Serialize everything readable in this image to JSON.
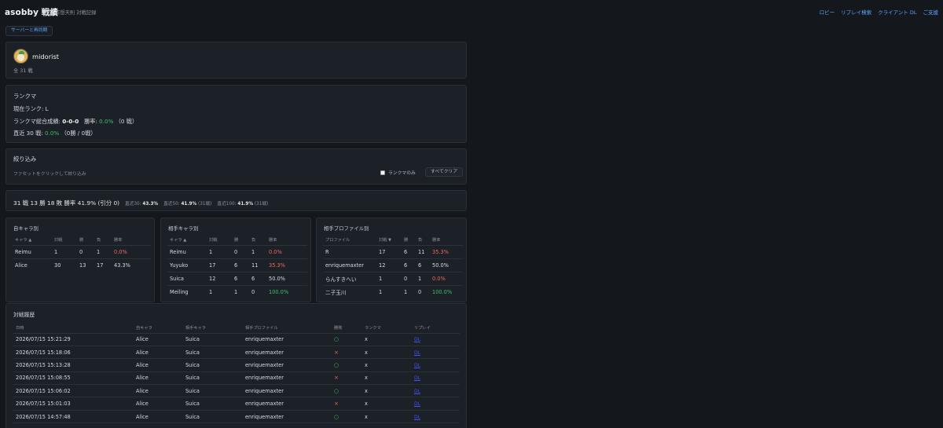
{
  "header": {
    "brand": "asobby 戦績",
    "subtitle": "非想天則 対戦記録",
    "nav": [
      "ロビー",
      "リプレイ検索",
      "クライアント DL",
      "ご支援"
    ]
  },
  "sync_button": "サーバーと再同期",
  "profile": {
    "name": "midorist",
    "total": "全 31 戦"
  },
  "ranked": {
    "title": "ランクマ",
    "current_rank_label": "現在ランク:",
    "current_rank": "L",
    "overall_label": "ランクマ総合成績:",
    "overall_record": "0-0-0",
    "winrate_label": "勝率:",
    "overall_winrate": "0.0%",
    "overall_games": "（0 戦）",
    "recent_label": "直近 30 戦:",
    "recent_winrate": "0.0%",
    "recent_detail": "（0勝 / 0戦）"
  },
  "filter": {
    "title": "絞り込み",
    "hint": "ファセットをクリックして絞り込み",
    "rank_only_label": "ランクマのみ",
    "clear_label": "すべてクリア"
  },
  "summary": {
    "main": "31 戦 13 勝 18 敗 勝率 41.9% (引分 0)",
    "recent": [
      {
        "label": "直近30:",
        "value": "43.3%",
        "note": ""
      },
      {
        "label": "直近50:",
        "value": "41.9%",
        "note": "(31戦)"
      },
      {
        "label": "直近100:",
        "value": "41.9%",
        "note": "(31戦)"
      }
    ]
  },
  "self_char": {
    "title": "自キャラ別",
    "headers": [
      "キャラ ▲",
      "対戦",
      "勝",
      "負",
      "勝率"
    ],
    "rows": [
      {
        "name": "Reimu",
        "games": "1",
        "wins": "0",
        "losses": "1",
        "rate": "0.0%",
        "color": "#f0685f"
      },
      {
        "name": "Alice",
        "games": "30",
        "wins": "13",
        "losses": "17",
        "rate": "43.3%",
        "color": "#d7dbe0"
      }
    ]
  },
  "opp_char": {
    "title": "相手キャラ別",
    "headers": [
      "キャラ ▲",
      "対戦",
      "勝",
      "負",
      "勝率"
    ],
    "rows": [
      {
        "name": "Reimu",
        "games": "1",
        "wins": "0",
        "losses": "1",
        "rate": "0.0%",
        "color": "#f0685f"
      },
      {
        "name": "Yuyuko",
        "games": "17",
        "wins": "6",
        "losses": "11",
        "rate": "35.3%",
        "color": "#f0685f"
      },
      {
        "name": "Suica",
        "games": "12",
        "wins": "6",
        "losses": "6",
        "rate": "50.0%",
        "color": "#d7dbe0"
      },
      {
        "name": "Meiling",
        "games": "1",
        "wins": "1",
        "losses": "0",
        "rate": "100.0%",
        "color": "#3fbf6a"
      }
    ]
  },
  "opp_profile": {
    "title": "相手プロファイル別",
    "headers": [
      "プロファイル",
      "対戦 ▼",
      "勝",
      "負",
      "勝率"
    ],
    "rows": [
      {
        "name": "R",
        "games": "17",
        "wins": "6",
        "losses": "11",
        "rate": "35.3%",
        "color": "#f0685f"
      },
      {
        "name": "enriquemaxter",
        "games": "12",
        "wins": "6",
        "losses": "6",
        "rate": "50.0%",
        "color": "#d7dbe0"
      },
      {
        "name": "らんすきへい",
        "games": "1",
        "wins": "0",
        "losses": "1",
        "rate": "0.0%",
        "color": "#f0685f"
      },
      {
        "name": "二子玉川",
        "games": "1",
        "wins": "1",
        "losses": "0",
        "rate": "100.0%",
        "color": "#3fbf6a"
      }
    ]
  },
  "history": {
    "title": "対戦履歴",
    "headers": [
      "日時",
      "自キャラ",
      "相手キャラ",
      "相手プロファイル",
      "勝敗",
      "ランクマ",
      "リプレイ"
    ],
    "rows": [
      {
        "date": "2026/07/15 15:21:29",
        "self": "Alice",
        "opp": "Suica",
        "profile": "enriquemaxter",
        "result": "○",
        "win": true,
        "ranked": "x",
        "replay": "DL"
      },
      {
        "date": "2026/07/15 15:18:06",
        "self": "Alice",
        "opp": "Suica",
        "profile": "enriquemaxter",
        "result": "×",
        "win": false,
        "ranked": "x",
        "replay": "DL"
      },
      {
        "date": "2026/07/15 15:13:28",
        "self": "Alice",
        "opp": "Suica",
        "profile": "enriquemaxter",
        "result": "○",
        "win": true,
        "ranked": "x",
        "replay": "DL"
      },
      {
        "date": "2026/07/15 15:08:55",
        "self": "Alice",
        "opp": "Suica",
        "profile": "enriquemaxter",
        "result": "×",
        "win": false,
        "ranked": "x",
        "replay": "DL"
      },
      {
        "date": "2026/07/15 15:06:02",
        "self": "Alice",
        "opp": "Suica",
        "profile": "enriquemaxter",
        "result": "○",
        "win": true,
        "ranked": "x",
        "replay": "DL"
      },
      {
        "date": "2026/07/15 15:01:03",
        "self": "Alice",
        "opp": "Suica",
        "profile": "enriquemaxter",
        "result": "×",
        "win": false,
        "ranked": "x",
        "replay": "DL"
      },
      {
        "date": "2026/07/15 14:57:48",
        "self": "Alice",
        "opp": "Suica",
        "profile": "enriquemaxter",
        "result": "○",
        "win": true,
        "ranked": "x",
        "replay": "DL"
      }
    ]
  },
  "colors": {
    "accent": "#5aa7ff",
    "win": "#3fbf6a",
    "lose": "#f0685f",
    "background": "#14171c",
    "card": "#1c2027"
  }
}
